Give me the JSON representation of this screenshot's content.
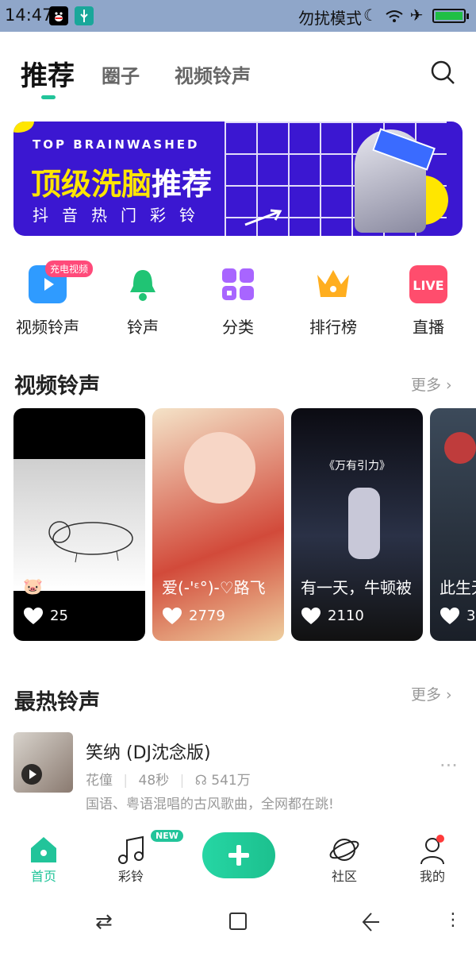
{
  "status_bar": {
    "time": "14:47",
    "mode_text": "勿扰模式",
    "icons": [
      "qq-icon",
      "usb-icon",
      "moon-icon",
      "wifi-icon",
      "airplane-icon",
      "battery-icon"
    ]
  },
  "header": {
    "tabs": [
      {
        "label": "推荐",
        "active": true
      },
      {
        "label": "圈子",
        "active": false
      },
      {
        "label": "视频铃声",
        "active": false
      }
    ]
  },
  "banner": {
    "top_text": "TOP BRAINWASHED",
    "title_yellow": "顶级洗脑",
    "title_white": "推荐",
    "subtitle": "抖音热门彩铃"
  },
  "categories": [
    {
      "label": "视频铃声",
      "badge": "充电视频",
      "color": "#2f9bff"
    },
    {
      "label": "铃声",
      "color": "#20c474"
    },
    {
      "label": "分类",
      "color": "#a865ff"
    },
    {
      "label": "排行榜",
      "color": "#ffae1f"
    },
    {
      "label": "直播",
      "color": "#ff4d6d",
      "icon_text": "LIVE"
    }
  ],
  "video_section": {
    "title": "视频铃声",
    "more": "更多 ›",
    "cards": [
      {
        "title": "🐷",
        "likes": "25"
      },
      {
        "title": "爱(-'ᵋ°)-♡路飞",
        "likes": "2779"
      },
      {
        "title": "有一天，牛顿被",
        "likes": "2110",
        "overlay": "《万有引力》"
      },
      {
        "title": "此生无",
        "likes": "3"
      }
    ]
  },
  "hot_section": {
    "title": "最热铃声",
    "more": "更多 ›",
    "song": {
      "name": "笑纳 (DJ沈念版)",
      "artist": "花僮",
      "duration": "48秒",
      "plays": "541万",
      "description": "国语、粤语混唱的古风歌曲，全网都在跳!"
    }
  },
  "bottom_nav": {
    "items": [
      {
        "label": "首页",
        "active": true
      },
      {
        "label": "彩铃",
        "badge": "NEW"
      },
      {
        "label": "社区"
      },
      {
        "label": "我的"
      }
    ]
  },
  "system_nav": {
    "icons": [
      "switch-icon",
      "home-square-icon",
      "back-icon",
      "menu-icon"
    ]
  },
  "colors": {
    "accent": "#22c49a",
    "banner_bg": "#3b17d1",
    "banner_yellow": "#ffe600"
  }
}
